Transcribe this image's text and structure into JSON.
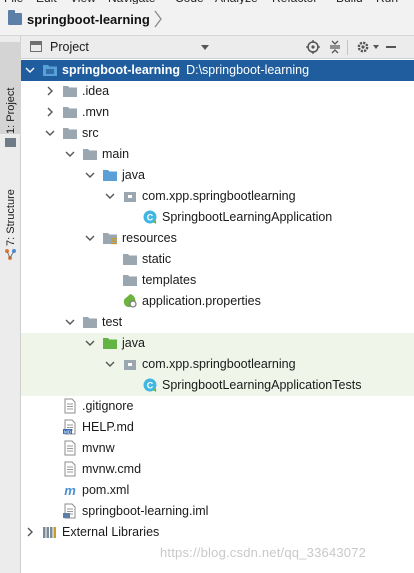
{
  "menu": [
    "File",
    "Edit",
    "View",
    "Navigate",
    "Code",
    "Analyze",
    "Refactor",
    "Build",
    "Run"
  ],
  "breadcrumb": {
    "project": "springboot-learning"
  },
  "left_tabs": {
    "project": "1: Project",
    "structure": "7: Structure"
  },
  "tool_window": {
    "title": "Project"
  },
  "tree": [
    {
      "label": "springboot-learning",
      "path": "D:\\springboot-learning",
      "bold": true,
      "selected": true,
      "expanded": true,
      "icon": "module-folder-icon",
      "depth": 0
    },
    {
      "label": ".idea",
      "expanded": false,
      "icon": "folder-icon",
      "depth": 1
    },
    {
      "label": ".mvn",
      "expanded": false,
      "icon": "folder-icon",
      "depth": 1
    },
    {
      "label": "src",
      "expanded": true,
      "icon": "folder-icon",
      "depth": 1
    },
    {
      "label": "main",
      "expanded": true,
      "icon": "folder-icon",
      "depth": 2
    },
    {
      "label": "java",
      "expanded": true,
      "icon": "source-root-folder-icon",
      "depth": 3
    },
    {
      "label": "com.xpp.springbootlearning",
      "expanded": true,
      "icon": "package-icon",
      "depth": 4
    },
    {
      "label": "SpringbootLearningApplication",
      "icon": "spring-class-icon",
      "depth": 5
    },
    {
      "label": "resources",
      "expanded": true,
      "icon": "resources-folder-icon",
      "depth": 3
    },
    {
      "label": "static",
      "icon": "folder-icon",
      "depth": 4
    },
    {
      "label": "templates",
      "icon": "folder-icon",
      "depth": 4
    },
    {
      "label": "application.properties",
      "icon": "spring-properties-icon",
      "depth": 4
    },
    {
      "label": "test",
      "expanded": true,
      "icon": "folder-icon",
      "depth": 2
    },
    {
      "label": "java",
      "expanded": true,
      "icon": "test-root-folder-icon",
      "depth": 3,
      "test": true
    },
    {
      "label": "com.xpp.springbootlearning",
      "expanded": true,
      "icon": "package-icon",
      "depth": 4,
      "test": true
    },
    {
      "label": "SpringbootLearningApplicationTests",
      "icon": "spring-class-icon",
      "depth": 5,
      "test": true
    },
    {
      "label": ".gitignore",
      "icon": "text-file-icon",
      "depth": 1
    },
    {
      "label": "HELP.md",
      "icon": "markdown-file-icon",
      "depth": 1
    },
    {
      "label": "mvnw",
      "icon": "text-file-icon",
      "depth": 1
    },
    {
      "label": "mvnw.cmd",
      "icon": "text-file-icon",
      "depth": 1
    },
    {
      "label": "pom.xml",
      "icon": "maven-icon",
      "depth": 1
    },
    {
      "label": "springboot-learning.iml",
      "icon": "iml-file-icon",
      "depth": 1
    },
    {
      "label": "External Libraries",
      "expanded": false,
      "icon": "libraries-icon",
      "depth": 0
    }
  ],
  "watermark": "https://blog.csdn.net/qq_33643072",
  "colors": {
    "selection": "#1f5d9e",
    "test_row": "#eff6e9",
    "folder": "#9aa7b0",
    "source_root": "#5aa0d8",
    "test_root": "#62b543"
  }
}
